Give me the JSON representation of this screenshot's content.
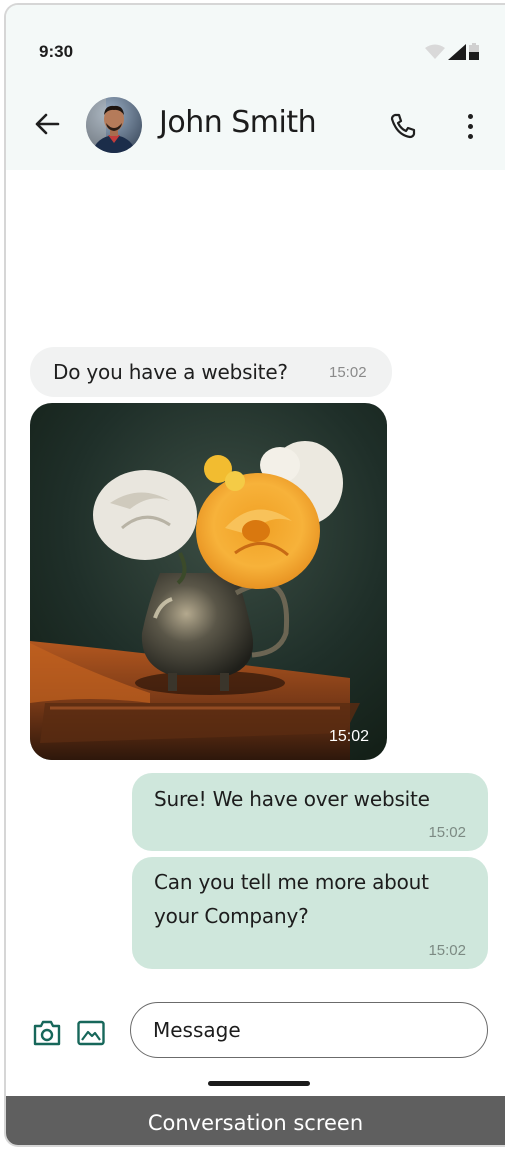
{
  "status_bar": {
    "time": "9:30"
  },
  "header": {
    "contact_name": "John Smith",
    "icons": {
      "back": "arrow-left-icon",
      "call": "phone-icon",
      "more": "more-vertical-icon"
    }
  },
  "messages": [
    {
      "direction": "incoming",
      "type": "text",
      "text": "Do you have a website?",
      "time": "15:02"
    },
    {
      "direction": "incoming",
      "type": "image",
      "subject": "flowers-in-vase-photo",
      "time": "15:02"
    },
    {
      "direction": "outgoing",
      "type": "text",
      "text": "Sure! We have over website",
      "time": "15:02"
    },
    {
      "direction": "outgoing",
      "type": "text",
      "text_lines": [
        "Can you tell me more about",
        "your Company?"
      ],
      "time": "15:02"
    }
  ],
  "composer": {
    "placeholder": "Message",
    "icons": {
      "camera": "camera-icon",
      "gallery": "image-gallery-icon"
    }
  },
  "caption": "Conversation screen",
  "colors": {
    "accent": "#17675a",
    "header_bg": "#f4f9f8",
    "incoming_bubble": "#f1f2f2",
    "outgoing_bubble": "#cfe7dc",
    "caption_bg": "#5f5f5f"
  }
}
